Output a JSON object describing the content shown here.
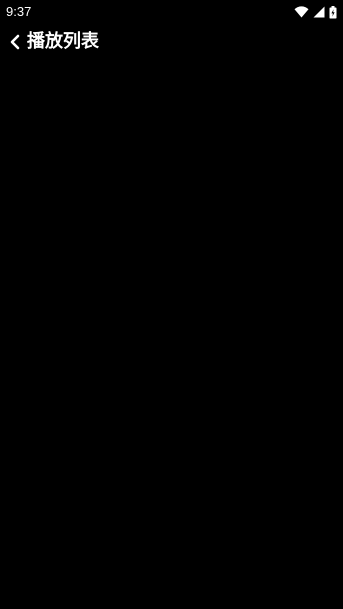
{
  "status_bar": {
    "time": "9:37",
    "icons": [
      "wifi-icon",
      "signal-icon",
      "battery-icon"
    ]
  },
  "header": {
    "title": "播放列表",
    "back_icon": "chevron-left-icon"
  },
  "colors": {
    "background": "#000000",
    "foreground": "#ffffff"
  }
}
